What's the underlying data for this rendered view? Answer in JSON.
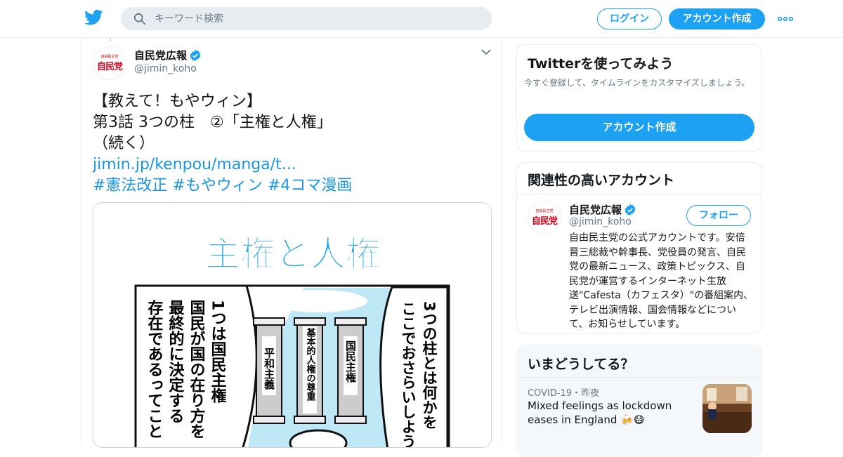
{
  "header": {
    "search_placeholder": "キーワード検索",
    "login_label": "ログイン",
    "signup_label": "アカウント作成"
  },
  "tweet": {
    "display_name": "自民党広報",
    "handle": "@jimin_koho",
    "avatar_small_text": "自由民主党",
    "avatar_text": "自民党",
    "lines": [
      "【教えて！もやウィン】",
      "第3話 3つの柱　②「主権と人権」",
      "（続く）"
    ],
    "link": "jimin.jp/kenpou/manga/t...",
    "hashtags": "#憲法改正 #もやウィン #4コマ漫画"
  },
  "manga": {
    "title": "主権と人権",
    "left_panel_lines": [
      "1つは国民主権",
      "国民が国の在り方を",
      "最終的に決定する",
      "存在であるってこと"
    ],
    "pillars": [
      "平和主義",
      "基本的人権の尊重",
      "国民主権"
    ],
    "right_panel_lines": [
      "3つの柱とは何かを",
      "ここでおさらいしよう"
    ]
  },
  "sidebar": {
    "try_twitter": {
      "title": "Twitterを使ってみよう",
      "description": "今すぐ登録して、タイムラインをカスタマイズしましょう。",
      "cta": "アカウント作成"
    },
    "related": {
      "title": "関連性の高いアカウント",
      "name": "自民党広報",
      "handle": "@jimin_koho",
      "follow_label": "フォロー",
      "bio": "自由民主党の公式アカウントです。安倍晋三総裁や幹事長、党役員の発言、自民党の最新ニュース、政策トピックス、自民党が運営するインターネット生放送\"Cafesta（カフェスタ）\"の番組案内、テレビ出演情報、国会情報などについて、お知らせしています。"
    },
    "trends": {
      "title": "いまどうしてる？",
      "meta": "COVID-19・昨夜",
      "headline": "Mixed feelings as lockdown eases in England 🍻😷"
    }
  },
  "colors": {
    "accent": "#1da1f2",
    "link": "#1b95e0",
    "manga_title": "#1aa3e8"
  }
}
